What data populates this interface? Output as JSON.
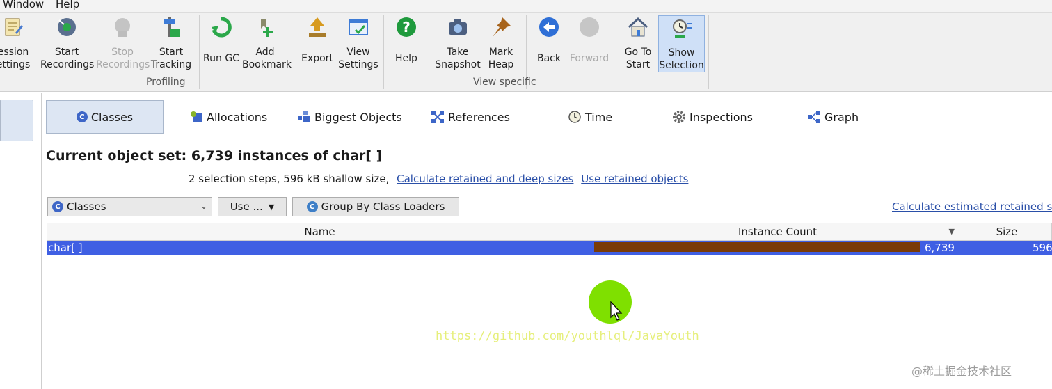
{
  "menu": {
    "window": "Window",
    "help": "Help"
  },
  "toolbar": {
    "session_settings": [
      "ession",
      "ettings"
    ],
    "start_recordings": [
      "Start",
      "Recordings"
    ],
    "stop_recordings": [
      "Stop",
      "Recordings"
    ],
    "start_tracking": [
      "Start",
      "Tracking"
    ],
    "run_gc": "Run GC",
    "add_bookmark": [
      "Add",
      "Bookmark"
    ],
    "export": "Export",
    "view_settings": [
      "View",
      "Settings"
    ],
    "help": "Help",
    "take_snapshot": [
      "Take",
      "Snapshot"
    ],
    "mark_heap": [
      "Mark",
      "Heap"
    ],
    "back": "Back",
    "forward": "Forward",
    "go_to_start": [
      "Go To",
      "Start"
    ],
    "show_selection": [
      "Show",
      "Selection"
    ],
    "groups": {
      "profiling": "Profiling",
      "view_specific": "View specific"
    }
  },
  "tabs": [
    {
      "label": "Classes",
      "icon": "class-icon"
    },
    {
      "label": "Allocations",
      "icon": "allocations-icon"
    },
    {
      "label": "Biggest Objects",
      "icon": "biggest-objects-icon"
    },
    {
      "label": "References",
      "icon": "references-icon"
    },
    {
      "label": "Time",
      "icon": "clock-icon"
    },
    {
      "label": "Inspections",
      "icon": "gear-icon"
    },
    {
      "label": "Graph",
      "icon": "graph-icon"
    }
  ],
  "object_set": {
    "title": "Current object set:  6,739 instances of char[ ]",
    "summary": "2 selection steps, 596 kB shallow size,",
    "link_retained_deep": "Calculate retained and deep sizes",
    "link_use_retained": "Use retained objects"
  },
  "controls": {
    "view_select": "Classes",
    "use_button": "Use ...",
    "group_button": "Group By Class Loaders",
    "calc_estimated": "Calculate estimated retained siz"
  },
  "table": {
    "columns": [
      "Name",
      "Instance Count",
      "Size"
    ],
    "rows": [
      {
        "name": "char[ ]",
        "instance_count": "6,739",
        "instance_fraction": 1.0,
        "size": "596"
      }
    ]
  },
  "overlay": {
    "watermark": "https://github.com/youthlql/JavaYouth",
    "corner": "@稀土掘金技术社区"
  },
  "colors": {
    "selection_row": "#3f5fe3",
    "count_bar": "#7a3b06",
    "link": "#2a4fa8",
    "cursor_halo": "#7fe000"
  }
}
